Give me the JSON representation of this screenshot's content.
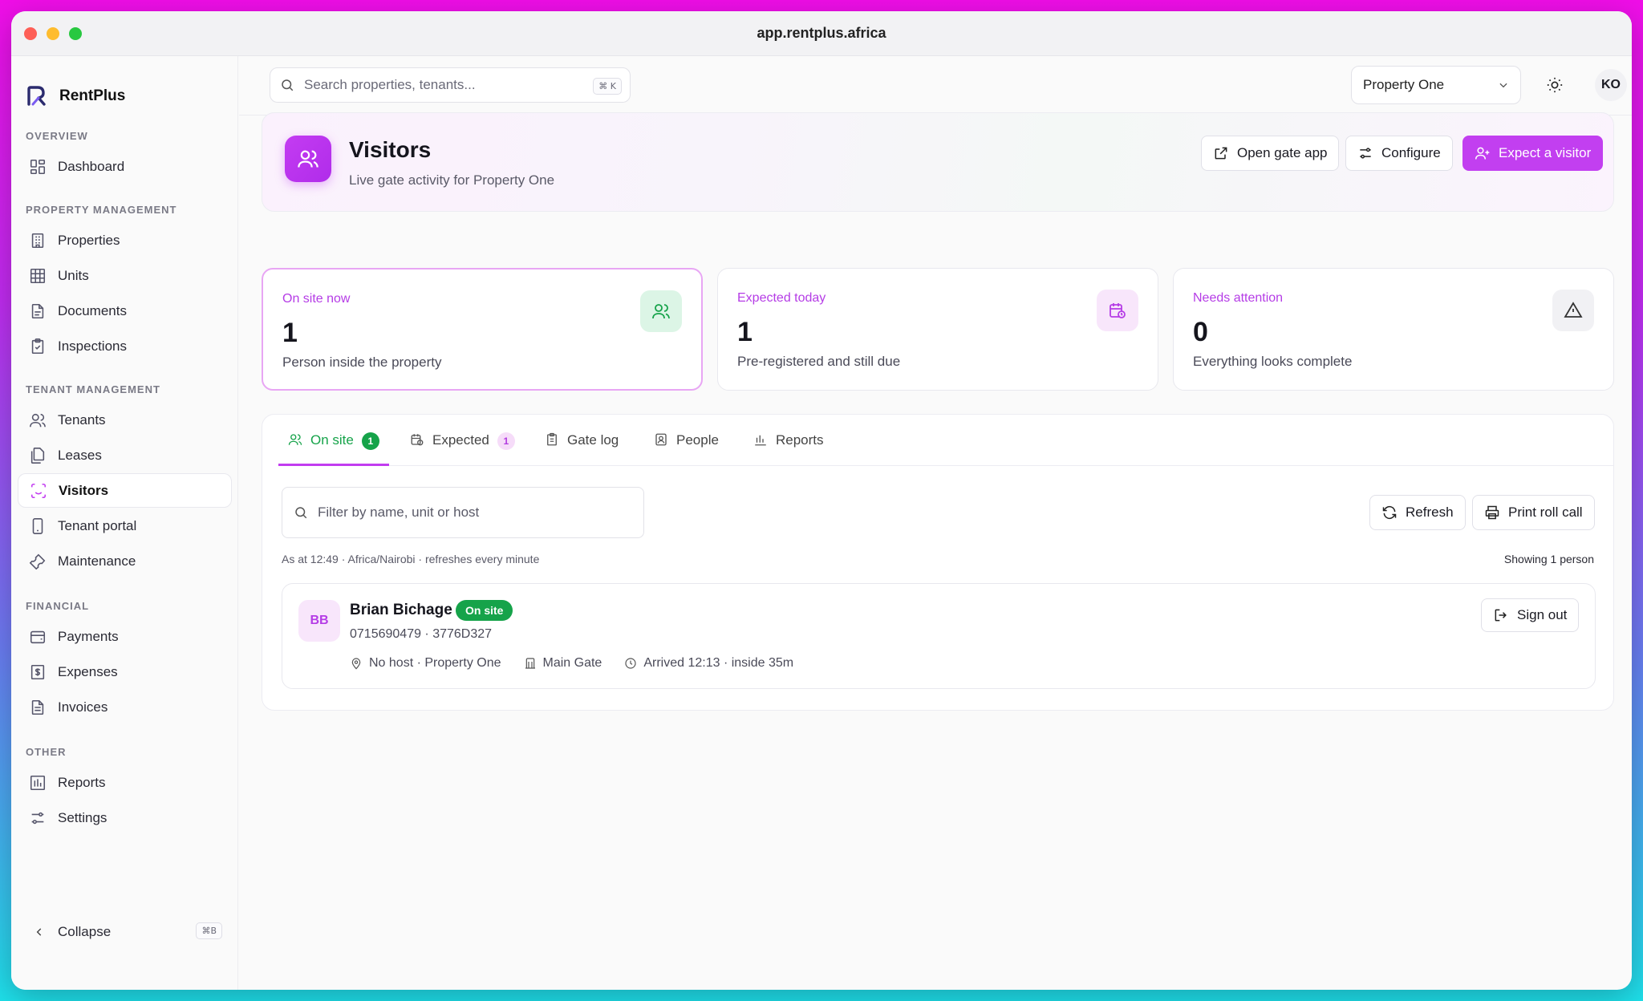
{
  "window": {
    "url": "app.rentplus.africa"
  },
  "brand": {
    "name": "RentPlus"
  },
  "sidebar": {
    "sections": [
      {
        "title": "OVERVIEW",
        "items": [
          {
            "label": "Dashboard",
            "icon": "dashboard-icon"
          }
        ]
      },
      {
        "title": "PROPERTY MANAGEMENT",
        "items": [
          {
            "label": "Properties",
            "icon": "building-icon"
          },
          {
            "label": "Units",
            "icon": "grid-icon"
          },
          {
            "label": "Documents",
            "icon": "document-icon"
          },
          {
            "label": "Inspections",
            "icon": "clipboard-check-icon"
          }
        ]
      },
      {
        "title": "TENANT MANAGEMENT",
        "items": [
          {
            "label": "Tenants",
            "icon": "users-icon"
          },
          {
            "label": "Leases",
            "icon": "files-icon"
          },
          {
            "label": "Visitors",
            "icon": "scan-face-icon",
            "active": true
          },
          {
            "label": "Tenant portal",
            "icon": "phone-icon"
          },
          {
            "label": "Maintenance",
            "icon": "wrench-icon"
          }
        ]
      },
      {
        "title": "FINANCIAL",
        "items": [
          {
            "label": "Payments",
            "icon": "wallet-icon"
          },
          {
            "label": "Expenses",
            "icon": "receipt-icon"
          },
          {
            "label": "Invoices",
            "icon": "invoice-icon"
          }
        ]
      },
      {
        "title": "OTHER",
        "items": [
          {
            "label": "Reports",
            "icon": "bar-chart-icon"
          },
          {
            "label": "Settings",
            "icon": "sliders-icon"
          }
        ]
      }
    ],
    "collapse_label": "Collapse",
    "collapse_shortcut": "⌘B"
  },
  "topbar": {
    "search_placeholder": "Search properties, tenants...",
    "search_shortcut": "⌘ K",
    "property_selected": "Property One",
    "user_initials": "KO"
  },
  "header": {
    "title": "Visitors",
    "subtitle": "Live gate activity for Property One",
    "open_gate_label": "Open gate app",
    "configure_label": "Configure",
    "expect_label": "Expect a visitor"
  },
  "stats": [
    {
      "label": "On site now",
      "value": "1",
      "desc": "Person inside the property"
    },
    {
      "label": "Expected today",
      "value": "1",
      "desc": "Pre-registered and still due"
    },
    {
      "label": "Needs attention",
      "value": "0",
      "desc": "Everything looks complete"
    }
  ],
  "tabs": [
    {
      "label": "On site",
      "count": "1"
    },
    {
      "label": "Expected",
      "count": "1"
    },
    {
      "label": "Gate log"
    },
    {
      "label": "People"
    },
    {
      "label": "Reports"
    }
  ],
  "panel": {
    "filter_placeholder": "Filter by name, unit or host",
    "refresh_label": "Refresh",
    "print_label": "Print roll call",
    "as_at": "As at 12:49 · Africa/Nairobi · refreshes every minute",
    "showing": "Showing 1 person"
  },
  "visitor": {
    "initials": "BB",
    "name": "Brian Bichage",
    "status": "On site",
    "contact": "0715690479 · 3776D327",
    "host": "No host · Property One",
    "gate": "Main Gate",
    "arrived": "Arrived 12:13 · inside 35m",
    "sign_out_label": "Sign out"
  },
  "colors": {
    "accent": "#c23ff0",
    "success": "#16a34a"
  }
}
